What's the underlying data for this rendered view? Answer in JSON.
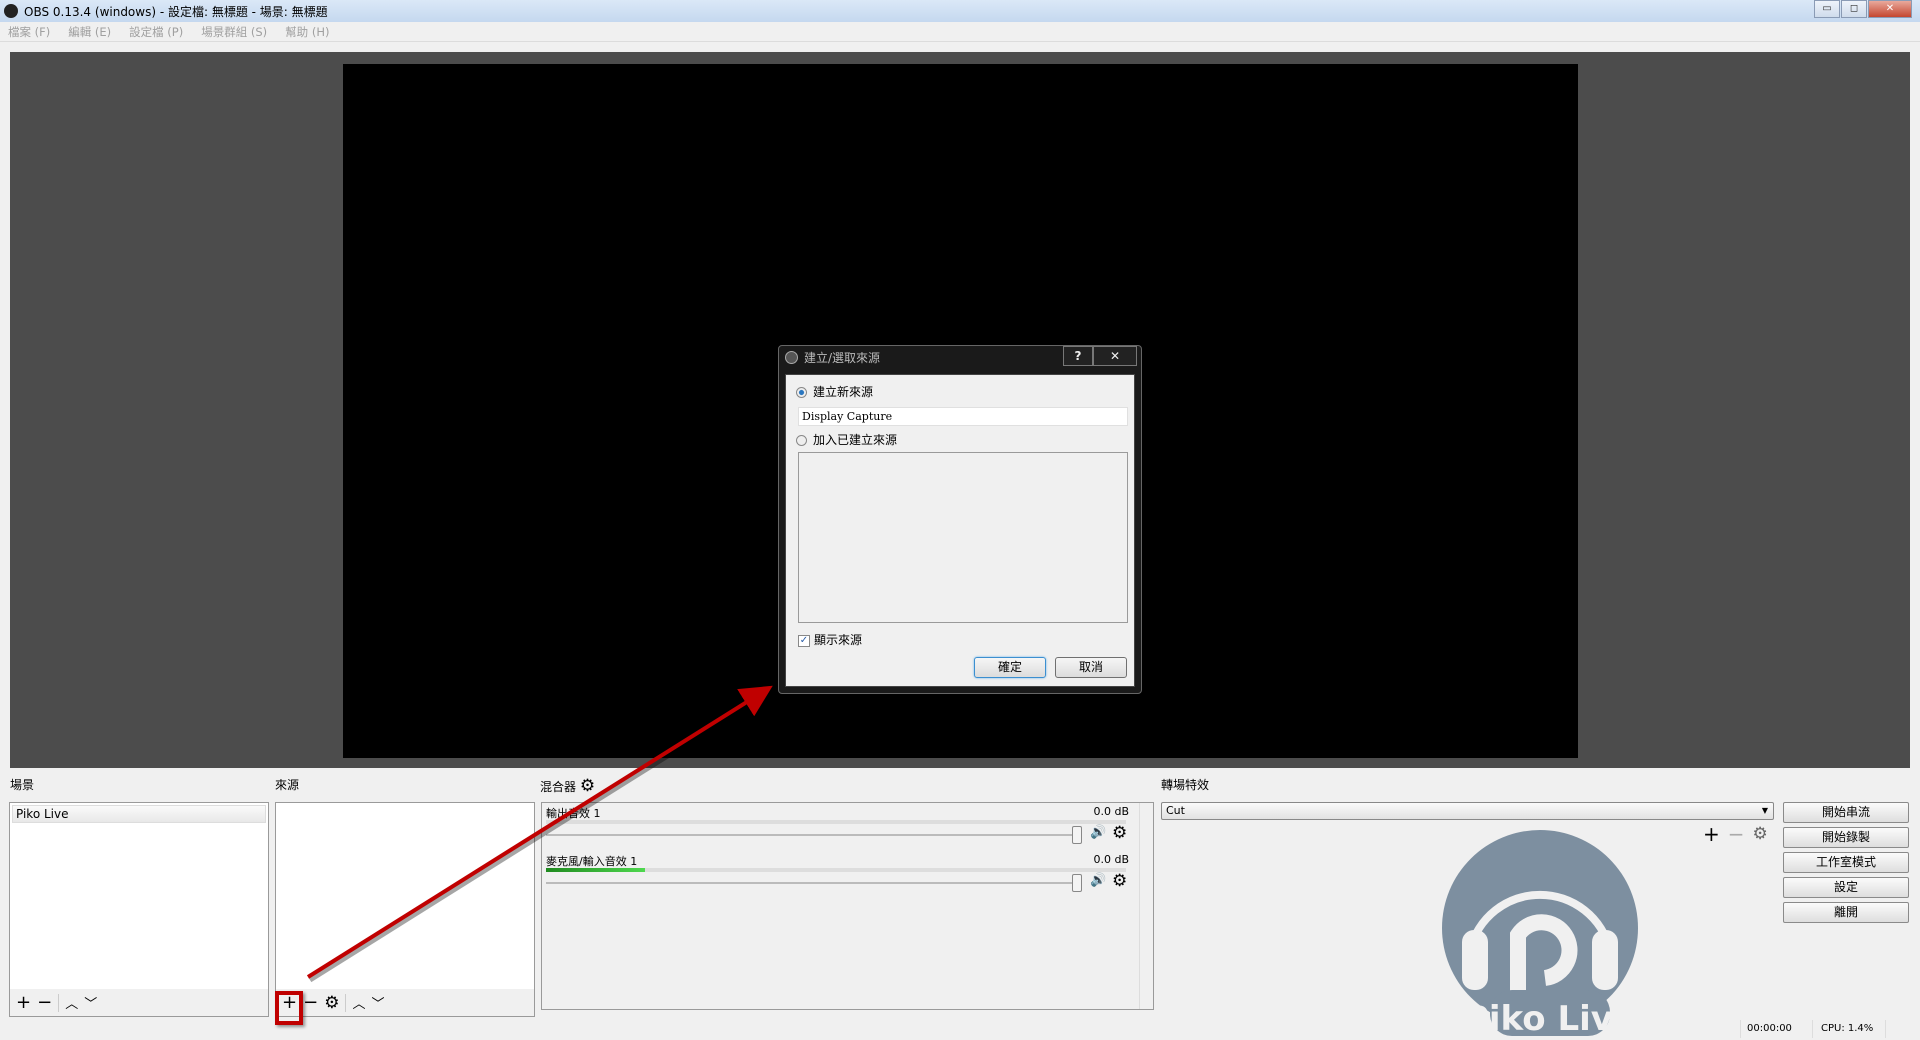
{
  "window": {
    "title": "OBS 0.13.4 (windows) - 設定檔: 無標題 - 場景: 無標題",
    "minimize": "▭",
    "maximize": "◻",
    "close": "✕"
  },
  "menu": [
    "檔案 (F)",
    "編輯 (E)",
    "設定檔 (P)",
    "場景群組 (S)",
    "幫助 (H)"
  ],
  "dialog": {
    "title": "建立/選取來源",
    "help": "?",
    "close": "✕",
    "create_new_label": "建立新來源",
    "name_value": "Display Capture",
    "add_existing_label": "加入已建立來源",
    "show_source_label": "顯示來源",
    "show_source_checked": true,
    "create_new_selected": true,
    "ok": "確定",
    "cancel": "取消"
  },
  "scenes": {
    "label": "場景",
    "items": [
      "Piko Live"
    ]
  },
  "sources": {
    "label": "來源",
    "items": []
  },
  "toolbar_glyphs": {
    "add": "+",
    "remove": "−",
    "up": "︿",
    "down": "﹀",
    "gear": "⚙"
  },
  "mixer": {
    "label": "混合器",
    "channels": [
      {
        "name": "輸出音效 1",
        "db": "0.0 dB",
        "level": 0
      },
      {
        "name": "麥克風/輸入音效 1",
        "db": "0.0 dB",
        "level": 0.17
      }
    ],
    "speaker": "🔊"
  },
  "transitions": {
    "label": "轉場特效",
    "selected": "Cut"
  },
  "controls": [
    "開始串流",
    "開始錄製",
    "工作室模式",
    "設定",
    "離開"
  ],
  "status": {
    "time": "00:00:00",
    "cpu": "CPU: 1.4%"
  },
  "watermark": {
    "text": "Piko Live"
  },
  "colors": {
    "annotation": "#c00000",
    "logo": "#7d8fa0",
    "meter": "#2fb52f"
  }
}
